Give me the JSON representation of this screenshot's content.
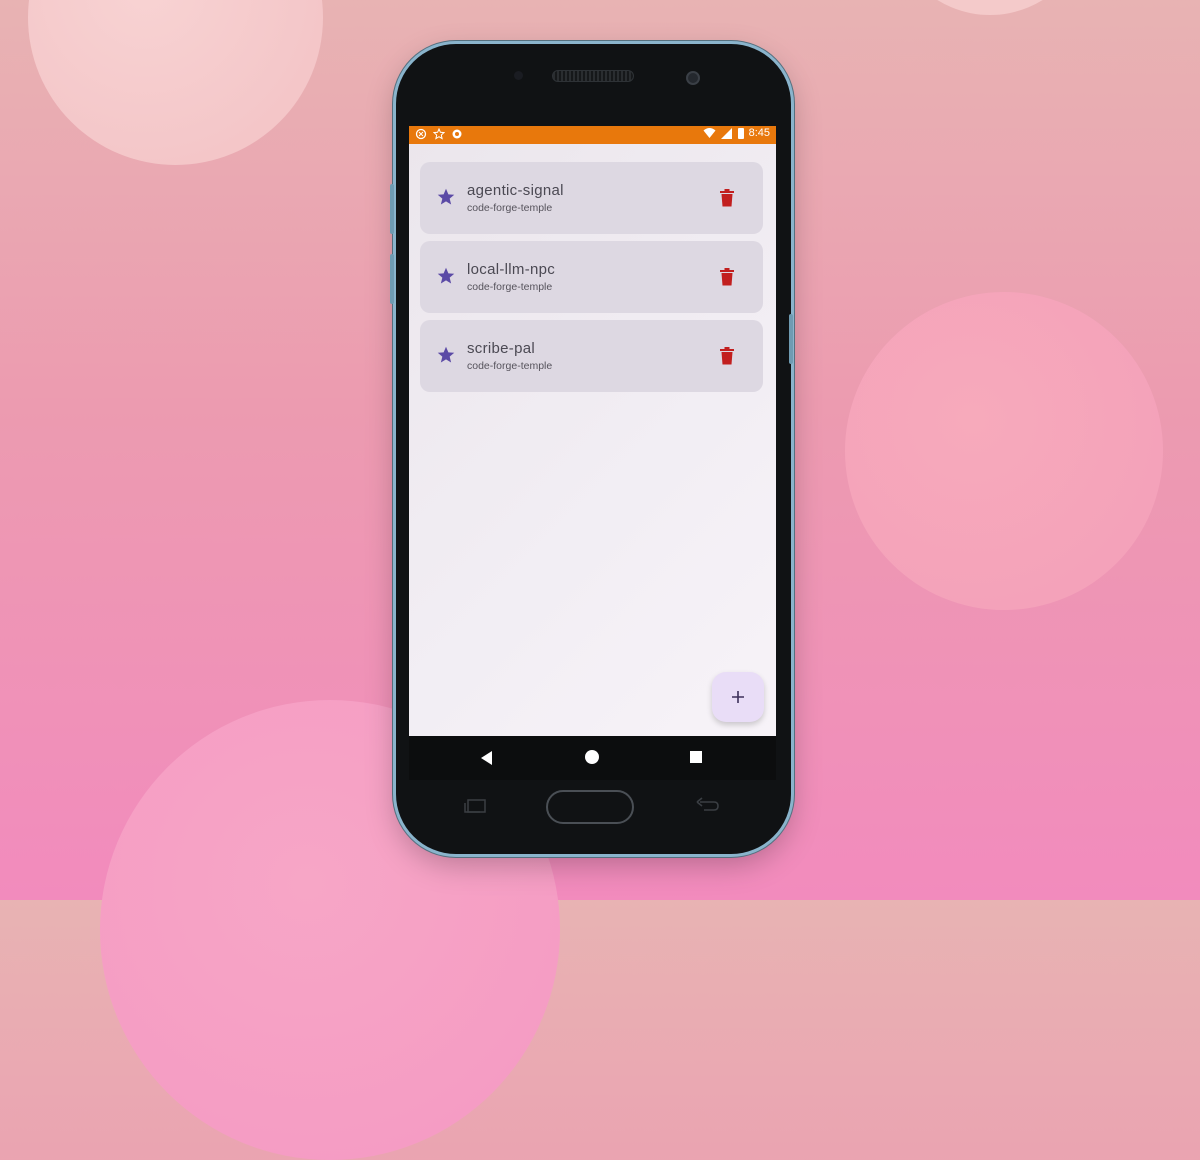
{
  "status_bar": {
    "time": "8:45",
    "left_icons": [
      "notification-icon",
      "star-outline-icon",
      "settings-icon"
    ],
    "right_icons": [
      "wifi-icon",
      "signal-icon",
      "battery-icon"
    ],
    "color": "#e8780c"
  },
  "repositories": [
    {
      "name": "agentic-signal",
      "owner": "code-forge-temple",
      "icon": "star-icon"
    },
    {
      "name": "local-llm-npc",
      "owner": "code-forge-temple",
      "icon": "star-icon"
    },
    {
      "name": "scribe-pal",
      "owner": "code-forge-temple",
      "icon": "star-icon"
    }
  ],
  "colors": {
    "star": "#5b4aa6",
    "delete": "#c21f1f",
    "fab_bg": "#e9ddf7"
  },
  "fab": {
    "label": "+",
    "icon": "plus-icon"
  },
  "nav": {
    "items": [
      "back-icon",
      "home-icon",
      "recent-apps-icon"
    ]
  }
}
